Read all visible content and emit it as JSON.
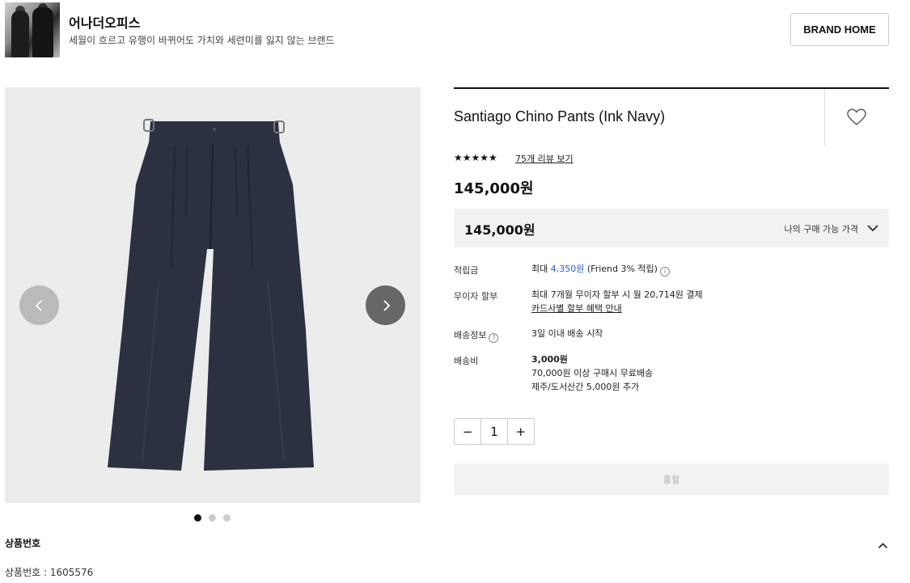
{
  "brand": {
    "name": "어나더오피스",
    "description": "세월이 흐르고 유행이 바뀌어도 가치와 세련미를 잃지 않는 브랜드",
    "home_button": "BRAND HOME"
  },
  "gallery": {
    "slide_count": 3,
    "active_slide": 1
  },
  "product": {
    "title": "Santiago Chino Pants (Ink Navy)",
    "rating_stars": "★★★★★",
    "review_link": "75개 리뷰 보기",
    "price": "145,000원",
    "price_box": {
      "price": "145,000원",
      "label": "나의 구매 가능 가격"
    },
    "points": {
      "label": "적립금",
      "prefix": "최대 ",
      "amount": "4,350원",
      "suffix": " (Friend 3% 적립)",
      "info_icon": "i"
    },
    "installment": {
      "label": "무이자 할부",
      "line1": "최대 7개월 무이자 할부 시 월 20,714원 결제",
      "link": "카드사별 할부 혜택 안내"
    },
    "shipping_info": {
      "label": "배송정보",
      "help_icon": "?",
      "value": "3일 이내 배송 시작"
    },
    "shipping_fee": {
      "label": "배송비",
      "amount": "3,000원",
      "free_note": "70,000원 이상 구매시 무료배송",
      "island_note": "제주/도서산간 5,000원 추가"
    },
    "quantity": {
      "minus": "−",
      "value": "1",
      "plus": "+"
    },
    "soldout_button": "품절"
  },
  "details": {
    "section_title": "상품번호",
    "product_number_line": "상품번호 : 1605576"
  },
  "colors": {
    "accent_blue": "#2a5bd7",
    "pants_navy": "#2b3140"
  }
}
